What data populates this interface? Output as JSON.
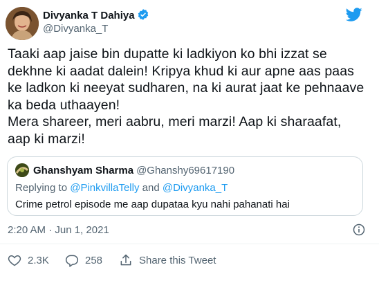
{
  "author": {
    "name": "Divyanka T Dahiya",
    "handle": "@Divyanka_T"
  },
  "tweet": {
    "text": "Taaki aap jaise bin dupatte ki ladkiyon ko bhi izzat se\ndekhne ki aadat dalein! Kripya khud ki aur apne aas paas\nke ladkon ki neeyat sudharen, na ki aurat jaat ke pehnaave\nka beda uthaayen!\nMera shareer, meri aabru, meri marzi! Aap ki sharaafat,\naap ki marzi!",
    "timestamp": "2:20 AM · Jun 1, 2021"
  },
  "quoted": {
    "name": "Ghanshyam Sharma",
    "handle": "@Ghanshy69617190",
    "replying_prefix": "Replying to ",
    "reply_user_1": "@PinkvillaTelly",
    "reply_and": " and ",
    "reply_user_2": "@Divyanka_T",
    "text": "Crime petrol episode me aap dupataa kyu nahi pahanati hai"
  },
  "actions": {
    "likes": "2.3K",
    "replies": "258",
    "share_label": "Share this Tweet"
  },
  "colors": {
    "accent": "#1d9bf0",
    "text": "#0f1419",
    "secondary": "#536471",
    "like_red": "#f91880"
  }
}
